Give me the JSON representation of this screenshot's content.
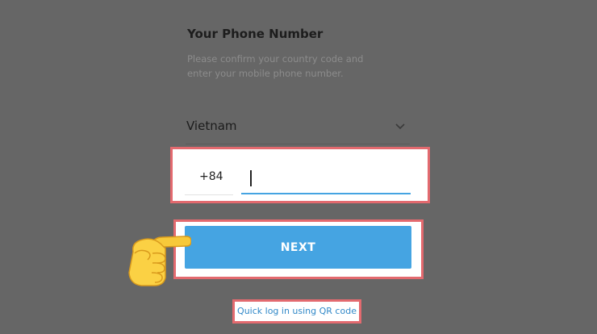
{
  "login": {
    "title": "Your Phone Number",
    "description_line1": "Please confirm your country code and",
    "description_line2": "enter your mobile phone number.",
    "country": {
      "selected": "Vietnam",
      "icon": "chevron-down-icon"
    },
    "phone": {
      "country_code": "+84",
      "number_value": ""
    },
    "next_label": "NEXT",
    "qr_link_label": "Quick log in using QR code"
  },
  "annotations": {
    "highlight_color": "#e36a6f",
    "pointer_icon": "pointing-hand-icon"
  },
  "colors": {
    "accent": "#45a4e2",
    "link": "#3088c8",
    "background": "#666666"
  }
}
